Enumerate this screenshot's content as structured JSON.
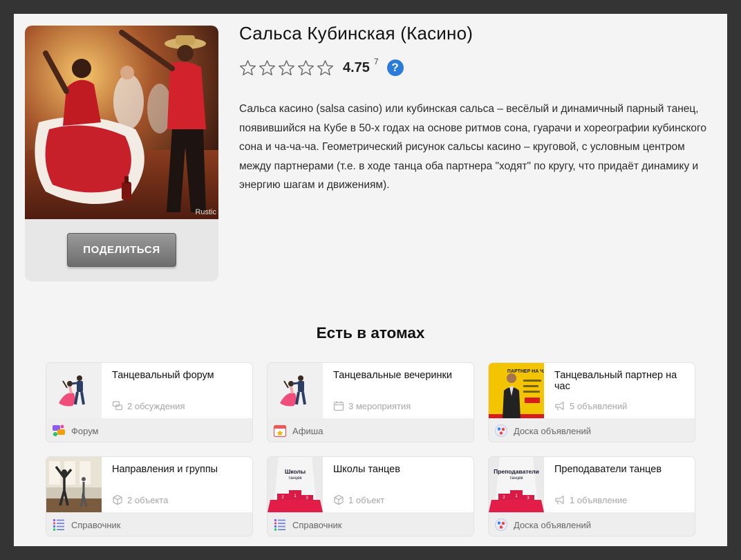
{
  "photo": {
    "credit": "Rustic"
  },
  "share_button": {
    "label": "ПОДЕЛИТЬСЯ"
  },
  "title": "Сальса Кубинская (Касино)",
  "rating": {
    "value": "4.75",
    "count": "7",
    "max_stars": 5,
    "icon": "help-icon"
  },
  "description": "Сальса касино (salsa casino) или кубинская сальса – весёлый и динамичный парный танец, появившийся на Кубе в 50-х годах на основе ритмов сона, гуарачи и хореографии кубинского сона и ча-ча-ча. Геометрический рисунок сальсы касино – круговой, с условным центром между партнерами (т.е. в ходе танца оба партнера \"ходят\" по кругу, что придаёт динамику и энергию шагам и движениям).",
  "atoms_section": {
    "title": "Есть в атомах",
    "items": [
      {
        "name": "Танцевальный форум",
        "meta": "2 обсуждения",
        "meta_icon": "discussion-icon",
        "category": "Форум",
        "category_icon": "forum-icon",
        "thumb": "dancing-couple-icon"
      },
      {
        "name": "Танцевальные вечеринки",
        "meta": "3 мероприятия",
        "meta_icon": "calendar-icon",
        "category": "Афиша",
        "category_icon": "poster-icon",
        "thumb": "dancing-couple-icon"
      },
      {
        "name": "Танцевальный партнер на час",
        "meta": "5 объявлений",
        "meta_icon": "megaphone-icon",
        "category": "Доска объявлений",
        "category_icon": "board-icon",
        "thumb": "partner-poster",
        "thumb_text": "ПАРТНЕР НА ЧАС"
      },
      {
        "name": "Направления и группы",
        "meta": "2 объекта",
        "meta_icon": "cube-icon",
        "category": "Справочник",
        "category_icon": "directory-icon",
        "thumb": "dance-studio-photo"
      },
      {
        "name": "Школы танцев",
        "meta": "1 объект",
        "meta_icon": "cube-icon",
        "category": "Справочник",
        "category_icon": "directory-icon",
        "thumb": "podium-icon",
        "thumb_text": "Школы танцев"
      },
      {
        "name": "Преподаватели танцев",
        "meta": "1 объявление",
        "meta_icon": "megaphone-icon",
        "category": "Доска объявлений",
        "category_icon": "board-icon",
        "thumb": "podium-icon",
        "thumb_text": "Преподаватели танцев"
      }
    ]
  },
  "colors": {
    "page_bg": "#f4f4f4",
    "frame": "#343434",
    "accent_blue": "#2b7bd8",
    "podium_red": "#d81b46",
    "poster_yellow": "#f2c500"
  }
}
